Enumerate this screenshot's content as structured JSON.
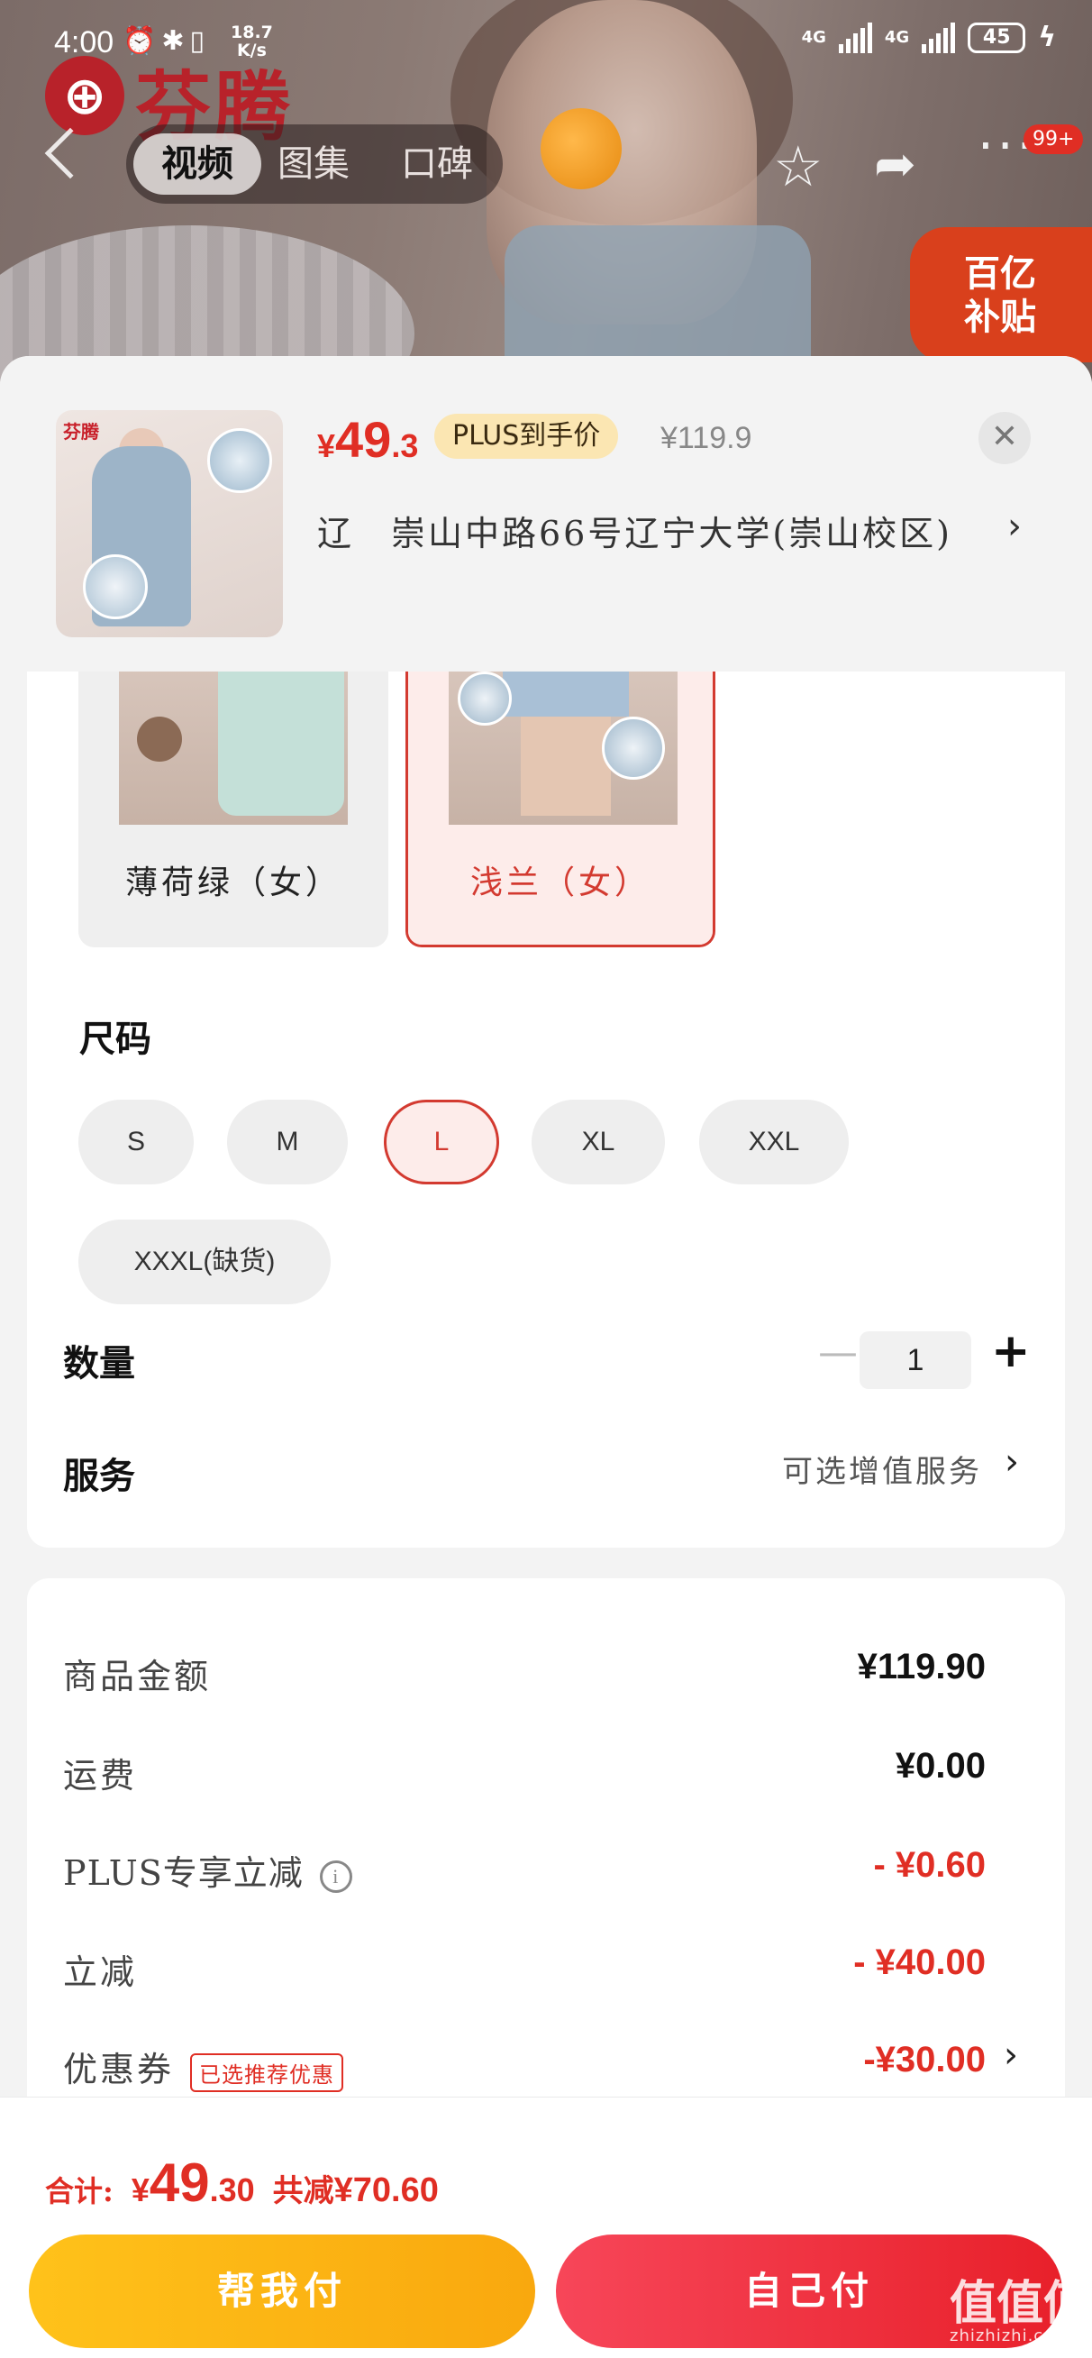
{
  "status_bar": {
    "time": "4:00",
    "speed_value": "18.7",
    "speed_unit": "K/s",
    "network_1": "4G",
    "network_2": "4G",
    "battery": "45"
  },
  "top_nav": {
    "tabs": [
      {
        "label": "视频",
        "active": true
      },
      {
        "label": "图集",
        "active": false
      },
      {
        "label": "口碑",
        "active": false
      }
    ],
    "badge": "99+"
  },
  "hero": {
    "brand_text": "芬腾",
    "subsidy_line1": "百亿",
    "subsidy_line2": "补贴"
  },
  "product": {
    "thumb_brand": "芬腾",
    "price_currency": "¥",
    "price_int": "49",
    "price_dec": ".3",
    "plus_tag": "PLUS到手价",
    "original_price": "¥119.9",
    "address": "辽　崇山中路66号辽宁大学(崇山校区)"
  },
  "colors": [
    {
      "label": "薄荷绿（女）",
      "selected": false
    },
    {
      "label": "浅兰（女）",
      "selected": true
    }
  ],
  "size": {
    "title": "尺码",
    "options": [
      {
        "label": "S",
        "selected": false
      },
      {
        "label": "M",
        "selected": false
      },
      {
        "label": "L",
        "selected": true
      },
      {
        "label": "XL",
        "selected": false
      },
      {
        "label": "XXL",
        "selected": false
      },
      {
        "label": "XXXL(缺货)",
        "selected": false
      }
    ]
  },
  "quantity": {
    "title": "数量",
    "value": "1"
  },
  "service": {
    "title": "服务",
    "link": "可选增值服务"
  },
  "price_breakdown": [
    {
      "label": "商品金额",
      "value": "¥119.90",
      "red": false
    },
    {
      "label": "运费",
      "value": "¥0.00",
      "red": false
    },
    {
      "label": "PLUS专享立减",
      "value": "- ¥0.60",
      "red": true
    },
    {
      "label": "立减",
      "value": "- ¥40.00",
      "red": true
    },
    {
      "label": "优惠券",
      "value": "-¥30.00",
      "red": true,
      "tag": "已选推荐优惠"
    }
  ],
  "footer": {
    "total_label": "合计:",
    "total_currency": "¥",
    "total_int": "49",
    "total_dec": ".30",
    "save_label": "共减",
    "save_value": "¥70.60",
    "btn_help": "帮我付",
    "btn_self": "自己付"
  },
  "watermark": {
    "text": "值值值",
    "domain": "zhizhizhi.com"
  },
  "colors_theme": {
    "accent_red": "#e02e24",
    "button_yellow": "#ffc21a",
    "button_red": "#e8202a",
    "plus_tag_bg": "#fbe6b2"
  }
}
